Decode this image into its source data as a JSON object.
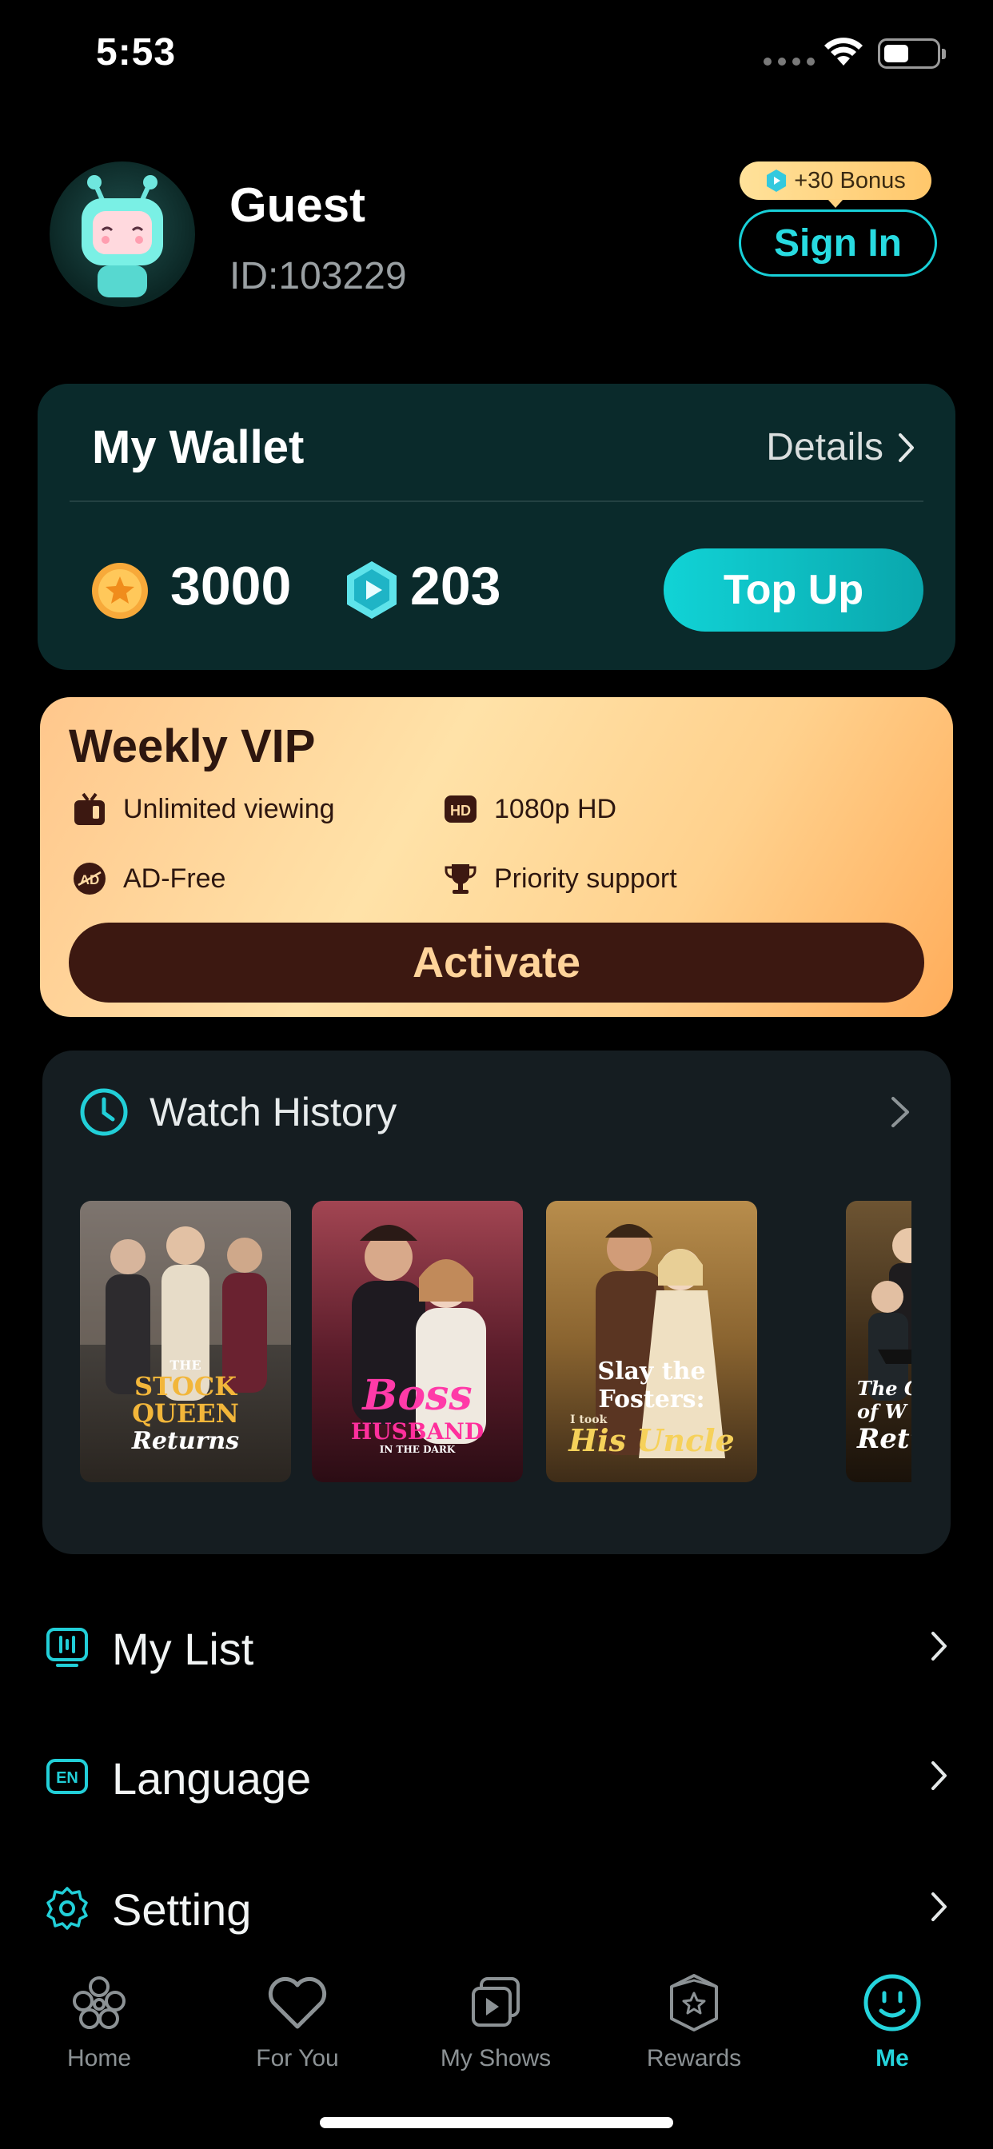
{
  "status_bar": {
    "time": "5:53"
  },
  "profile": {
    "name": "Guest",
    "id_text": "ID:103229"
  },
  "bonus": {
    "label": "+30 Bonus"
  },
  "sign_in": {
    "label": "Sign In"
  },
  "wallet": {
    "title": "My Wallet",
    "details_label": "Details",
    "coins": "3000",
    "gems": "203",
    "top_up_label": "Top Up"
  },
  "vip": {
    "title": "Weekly VIP",
    "features": [
      "Unlimited viewing",
      "1080p HD",
      "AD-Free",
      "Priority support"
    ],
    "activate_label": "Activate"
  },
  "watch_history": {
    "title": "Watch History",
    "posters": [
      {
        "line1": "THE",
        "line2": "STOCK QUEEN",
        "line3": "Returns"
      },
      {
        "line1": "Boss",
        "line2": "HUSBAND",
        "line3": "IN THE DARK"
      },
      {
        "line1": "Slay the Fosters:",
        "line2": "I took",
        "line3": "His Uncle"
      },
      {
        "line1": "The God of W",
        "line2": "Return"
      }
    ]
  },
  "menu": [
    {
      "label": "My List",
      "icon": "tv-list-icon"
    },
    {
      "label": "Language",
      "icon": "language-en-icon"
    },
    {
      "label": "Setting",
      "icon": "gear-icon"
    }
  ],
  "tabs": [
    {
      "label": "Home",
      "icon": "home-flower-icon"
    },
    {
      "label": "For You",
      "icon": "heart-icon"
    },
    {
      "label": "My Shows",
      "icon": "play-stack-icon"
    },
    {
      "label": "Rewards",
      "icon": "rewards-badge-icon"
    },
    {
      "label": "Me",
      "icon": "smiley-face-icon",
      "active": true
    }
  ],
  "colors": {
    "accent": "#25d4dc",
    "wallet_bg": "#0a2a2b",
    "vip_gradient_start": "#ffc78c",
    "vip_gradient_end": "#ffad5b",
    "activate_bg": "#3c1811"
  }
}
